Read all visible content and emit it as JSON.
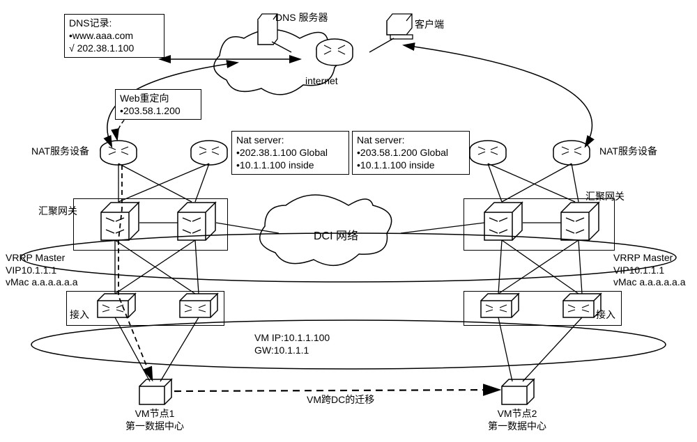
{
  "dns_box": {
    "title": "DNS记录:",
    "line1": "•www.aaa.com",
    "line2": "√ 202.38.1.100"
  },
  "top": {
    "dns_server": "DNS 服务器",
    "client": "客户端",
    "cloud": "internet"
  },
  "web_redirect": {
    "title": "Web重定向",
    "line1": "•203.58.1.200"
  },
  "nat_left": {
    "title": "Nat server:",
    "line1": "•202.38.1.100  Global",
    "line2": "•10.1.1.100    inside"
  },
  "nat_right": {
    "title": "Nat server:",
    "line1": "•203.58.1.200 Global",
    "line2": "•10.1.1.100   inside"
  },
  "labels": {
    "nat_dev_l": "NAT服务设备",
    "nat_dev_r": "NAT服务设备",
    "agg_l": "汇聚网关",
    "agg_r": "汇聚网关",
    "dci": "DCI 网络",
    "vrrp_l1": "VRRP Master",
    "vrrp_l2": "VIP10.1.1.1",
    "vrrp_l3": "vMac a.a.a.a.a.a",
    "vrrp_r1": "VRRP Master",
    "vrrp_r2": "VIP10.1.1.1",
    "vrrp_r3": "vMac a.a.a.a.a.a",
    "access_l": "接入",
    "access_r": "接入",
    "vm_info1": "VM IP:10.1.1.100",
    "vm_info2": "GW:10.1.1.1",
    "migrate": "VM跨DC的迁移",
    "vm1_l1": "VM节点1",
    "vm1_l2": "第一数据中心",
    "vm2_l1": "VM节点2",
    "vm2_l2": "第一数据中心"
  }
}
